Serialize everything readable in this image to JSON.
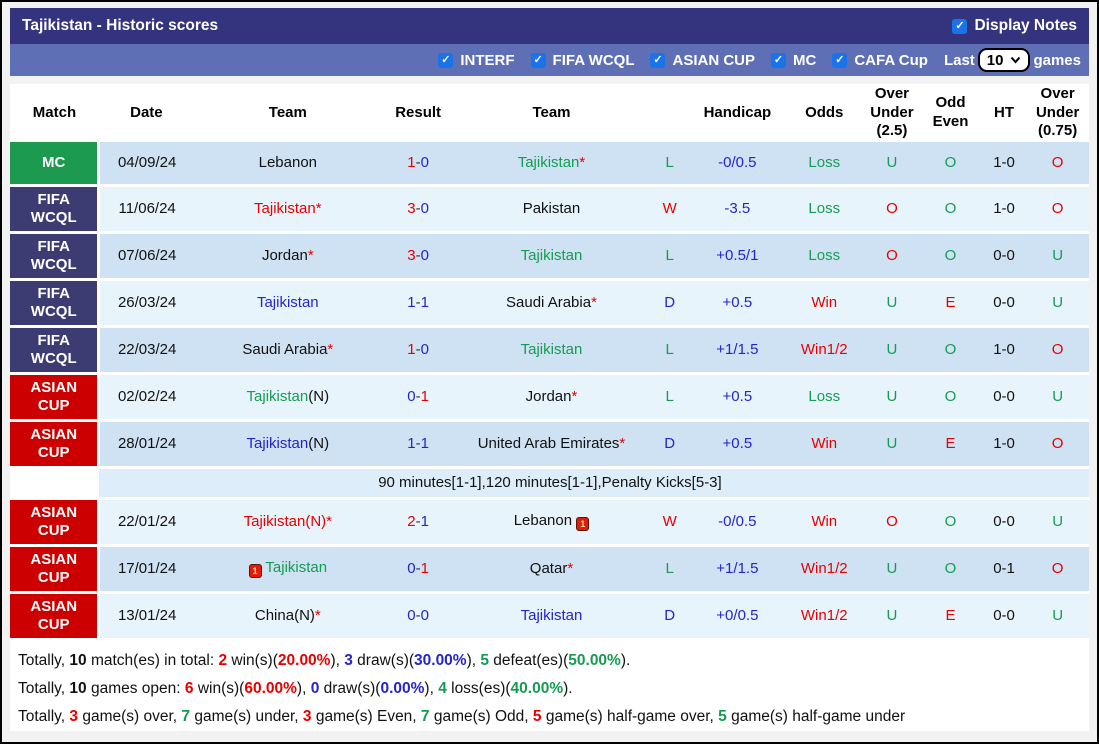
{
  "title_bar": {
    "title": "Tajikistan - Historic scores",
    "display_notes_label": "Display Notes",
    "display_notes_checked": true
  },
  "filter_bar": {
    "filters": [
      {
        "label": "INTERF",
        "checked": true
      },
      {
        "label": "FIFA WCQL",
        "checked": true
      },
      {
        "label": "ASIAN CUP",
        "checked": true
      },
      {
        "label": "MC",
        "checked": true
      },
      {
        "label": "CAFA Cup",
        "checked": true
      }
    ],
    "last_label": "Last",
    "last_value": "10",
    "games_label": "games"
  },
  "colors": {
    "red": "#e60000",
    "green": "#169b52",
    "blue": "#2424cc",
    "black": "#111111",
    "badge_mc": "#1c9b50",
    "badge_fifa": "#3d3c72",
    "badge_asian": "#cc0000",
    "row_dark": "#cfe2f3",
    "row_light": "#e8f4fc",
    "checkbox_blue": "#1a73e8",
    "title_bar_bg": "#34347e",
    "filter_bar_bg": "#5f6fb5"
  },
  "table": {
    "headers": [
      "Match",
      "Date",
      "Team",
      "Result",
      "Team",
      "",
      "Handicap",
      "Odds",
      "Over Under (2.5)",
      "Odd Even",
      "HT",
      "Over Under (0.75)"
    ],
    "rows": [
      {
        "badge": "MC",
        "badge_type": "mc",
        "date": "04/09/24",
        "t1": {
          "name": "Lebanon",
          "color": "black"
        },
        "res": {
          "l": "1",
          "lc": "red",
          "r": "0",
          "rc": "blue"
        },
        "t2": {
          "name": "Tajikistan",
          "color": "green",
          "star": true
        },
        "wdl": {
          "t": "L",
          "c": "green"
        },
        "hcp": "-0/0.5",
        "odds": {
          "t": "Loss",
          "c": "green"
        },
        "ou25": {
          "t": "U",
          "c": "green"
        },
        "oe": {
          "t": "O",
          "c": "green"
        },
        "ht": "1-0",
        "ou075": {
          "t": "O",
          "c": "red"
        },
        "shade": "dark"
      },
      {
        "badge": "FIFA WCQL",
        "badge_type": "fifa",
        "date": "11/06/24",
        "t1": {
          "name": "Tajikistan",
          "color": "red",
          "star": true
        },
        "res": {
          "l": "3",
          "lc": "red",
          "r": "0",
          "rc": "blue"
        },
        "t2": {
          "name": "Pakistan",
          "color": "black"
        },
        "wdl": {
          "t": "W",
          "c": "red"
        },
        "hcp": "-3.5",
        "odds": {
          "t": "Loss",
          "c": "green"
        },
        "ou25": {
          "t": "O",
          "c": "red"
        },
        "oe": {
          "t": "O",
          "c": "green"
        },
        "ht": "1-0",
        "ou075": {
          "t": "O",
          "c": "red"
        },
        "shade": "light"
      },
      {
        "badge": "FIFA WCQL",
        "badge_type": "fifa",
        "date": "07/06/24",
        "t1": {
          "name": "Jordan",
          "color": "black",
          "star": true
        },
        "res": {
          "l": "3",
          "lc": "red",
          "r": "0",
          "rc": "blue"
        },
        "t2": {
          "name": "Tajikistan",
          "color": "green"
        },
        "wdl": {
          "t": "L",
          "c": "green"
        },
        "hcp": "+0.5/1",
        "odds": {
          "t": "Loss",
          "c": "green"
        },
        "ou25": {
          "t": "O",
          "c": "red"
        },
        "oe": {
          "t": "O",
          "c": "green"
        },
        "ht": "0-0",
        "ou075": {
          "t": "U",
          "c": "green"
        },
        "shade": "dark"
      },
      {
        "badge": "FIFA WCQL",
        "badge_type": "fifa",
        "date": "26/03/24",
        "t1": {
          "name": "Tajikistan",
          "color": "blue"
        },
        "res": {
          "l": "1",
          "lc": "blue",
          "r": "1",
          "rc": "blue"
        },
        "t2": {
          "name": "Saudi Arabia",
          "color": "black",
          "star": true
        },
        "wdl": {
          "t": "D",
          "c": "blue"
        },
        "hcp": "+0.5",
        "odds": {
          "t": "Win",
          "c": "red"
        },
        "ou25": {
          "t": "U",
          "c": "green"
        },
        "oe": {
          "t": "E",
          "c": "red"
        },
        "ht": "0-0",
        "ou075": {
          "t": "U",
          "c": "green"
        },
        "shade": "light"
      },
      {
        "badge": "FIFA WCQL",
        "badge_type": "fifa",
        "date": "22/03/24",
        "t1": {
          "name": "Saudi Arabia",
          "color": "black",
          "star": true
        },
        "res": {
          "l": "1",
          "lc": "red",
          "r": "0",
          "rc": "blue"
        },
        "t2": {
          "name": "Tajikistan",
          "color": "green"
        },
        "wdl": {
          "t": "L",
          "c": "green"
        },
        "hcp": "+1/1.5",
        "odds": {
          "t": "Win1/2",
          "c": "red"
        },
        "ou25": {
          "t": "U",
          "c": "green"
        },
        "oe": {
          "t": "O",
          "c": "green"
        },
        "ht": "1-0",
        "ou075": {
          "t": "O",
          "c": "red"
        },
        "shade": "dark"
      },
      {
        "badge": "ASIAN CUP",
        "badge_type": "asian",
        "date": "02/02/24",
        "t1": {
          "name": "Tajikistan",
          "suffix": "(N)",
          "suffix_color": "black",
          "color": "green"
        },
        "res": {
          "l": "0",
          "lc": "blue",
          "r": "1",
          "rc": "red"
        },
        "t2": {
          "name": "Jordan",
          "color": "black",
          "star": true
        },
        "wdl": {
          "t": "L",
          "c": "green"
        },
        "hcp": "+0.5",
        "odds": {
          "t": "Loss",
          "c": "green"
        },
        "ou25": {
          "t": "U",
          "c": "green"
        },
        "oe": {
          "t": "O",
          "c": "green"
        },
        "ht": "0-0",
        "ou075": {
          "t": "U",
          "c": "green"
        },
        "shade": "light"
      },
      {
        "badge": "ASIAN CUP",
        "badge_type": "asian",
        "date": "28/01/24",
        "t1": {
          "name": "Tajikistan",
          "suffix": "(N)",
          "suffix_color": "black",
          "color": "blue"
        },
        "res": {
          "l": "1",
          "lc": "blue",
          "r": "1",
          "rc": "blue"
        },
        "t2": {
          "name": "United Arab Emirates",
          "color": "black",
          "star": true
        },
        "wdl": {
          "t": "D",
          "c": "blue"
        },
        "hcp": "+0.5",
        "odds": {
          "t": "Win",
          "c": "red"
        },
        "ou25": {
          "t": "U",
          "c": "green"
        },
        "oe": {
          "t": "E",
          "c": "red"
        },
        "ht": "1-0",
        "ou075": {
          "t": "O",
          "c": "red"
        },
        "shade": "dark"
      },
      {
        "type": "note",
        "text": "90 minutes[1-1],120 minutes[1-1],Penalty Kicks[5-3]"
      },
      {
        "badge": "ASIAN CUP",
        "badge_type": "asian",
        "date": "22/01/24",
        "t1": {
          "name": "Tajikistan",
          "suffix": "(N)",
          "suffix_color": "red",
          "color": "red",
          "star": true
        },
        "res": {
          "l": "2",
          "lc": "red",
          "r": "1",
          "rc": "blue"
        },
        "t2": {
          "name": "Lebanon",
          "color": "black",
          "card_after": true
        },
        "wdl": {
          "t": "W",
          "c": "red"
        },
        "hcp": "-0/0.5",
        "odds": {
          "t": "Win",
          "c": "red"
        },
        "ou25": {
          "t": "O",
          "c": "red"
        },
        "oe": {
          "t": "O",
          "c": "green"
        },
        "ht": "0-0",
        "ou075": {
          "t": "U",
          "c": "green"
        },
        "shade": "light"
      },
      {
        "badge": "ASIAN CUP",
        "badge_type": "asian",
        "date": "17/01/24",
        "t1": {
          "name": "Tajikistan",
          "color": "green",
          "card_before": true
        },
        "res": {
          "l": "0",
          "lc": "blue",
          "r": "1",
          "rc": "red"
        },
        "t2": {
          "name": "Qatar",
          "color": "black",
          "star": true
        },
        "wdl": {
          "t": "L",
          "c": "green"
        },
        "hcp": "+1/1.5",
        "odds": {
          "t": "Win1/2",
          "c": "red"
        },
        "ou25": {
          "t": "U",
          "c": "green"
        },
        "oe": {
          "t": "O",
          "c": "green"
        },
        "ht": "0-1",
        "ou075": {
          "t": "O",
          "c": "red"
        },
        "shade": "dark"
      },
      {
        "badge": "ASIAN CUP",
        "badge_type": "asian",
        "date": "13/01/24",
        "t1": {
          "name": "China",
          "suffix": "(N)",
          "suffix_color": "black",
          "color": "black",
          "star": true
        },
        "res": {
          "l": "0",
          "lc": "blue",
          "r": "0",
          "rc": "blue"
        },
        "t2": {
          "name": "Tajikistan",
          "color": "blue"
        },
        "wdl": {
          "t": "D",
          "c": "blue"
        },
        "hcp": "+0/0.5",
        "odds": {
          "t": "Win1/2",
          "c": "red"
        },
        "ou25": {
          "t": "U",
          "c": "green"
        },
        "oe": {
          "t": "E",
          "c": "red"
        },
        "ht": "0-0",
        "ou075": {
          "t": "U",
          "c": "green"
        },
        "shade": "light"
      }
    ]
  },
  "summary": {
    "lines": [
      {
        "segments": [
          {
            "t": "Totally, "
          },
          {
            "t": "10",
            "b": 1
          },
          {
            "t": " match(es) in total: "
          },
          {
            "t": "2",
            "b": 1,
            "c": "red"
          },
          {
            "t": " win(s)("
          },
          {
            "t": "20.00%",
            "b": 1,
            "c": "red"
          },
          {
            "t": "), "
          },
          {
            "t": "3",
            "b": 1,
            "c": "blue"
          },
          {
            "t": " draw(s)("
          },
          {
            "t": "30.00%",
            "b": 1,
            "c": "blue"
          },
          {
            "t": "), "
          },
          {
            "t": "5",
            "b": 1,
            "c": "green"
          },
          {
            "t": " defeat(es)("
          },
          {
            "t": "50.00%",
            "b": 1,
            "c": "green"
          },
          {
            "t": ")."
          }
        ]
      },
      {
        "segments": [
          {
            "t": "Totally, "
          },
          {
            "t": "10",
            "b": 1
          },
          {
            "t": " games open: "
          },
          {
            "t": "6",
            "b": 1,
            "c": "red"
          },
          {
            "t": " win(s)("
          },
          {
            "t": "60.00%",
            "b": 1,
            "c": "red"
          },
          {
            "t": "), "
          },
          {
            "t": "0",
            "b": 1,
            "c": "blue"
          },
          {
            "t": " draw(s)("
          },
          {
            "t": "0.00%",
            "b": 1,
            "c": "blue"
          },
          {
            "t": "), "
          },
          {
            "t": "4",
            "b": 1,
            "c": "green"
          },
          {
            "t": " loss(es)("
          },
          {
            "t": "40.00%",
            "b": 1,
            "c": "green"
          },
          {
            "t": ")."
          }
        ]
      },
      {
        "segments": [
          {
            "t": "Totally, "
          },
          {
            "t": "3",
            "b": 1,
            "c": "red"
          },
          {
            "t": " game(s) over, "
          },
          {
            "t": "7",
            "b": 1,
            "c": "green"
          },
          {
            "t": " game(s) under, "
          },
          {
            "t": "3",
            "b": 1,
            "c": "red"
          },
          {
            "t": " game(s) Even, "
          },
          {
            "t": "7",
            "b": 1,
            "c": "green"
          },
          {
            "t": " game(s) Odd, "
          },
          {
            "t": "5",
            "b": 1,
            "c": "red"
          },
          {
            "t": " game(s) half-game over, "
          },
          {
            "t": "5",
            "b": 1,
            "c": "green"
          },
          {
            "t": " game(s) half-game under"
          }
        ]
      }
    ]
  }
}
